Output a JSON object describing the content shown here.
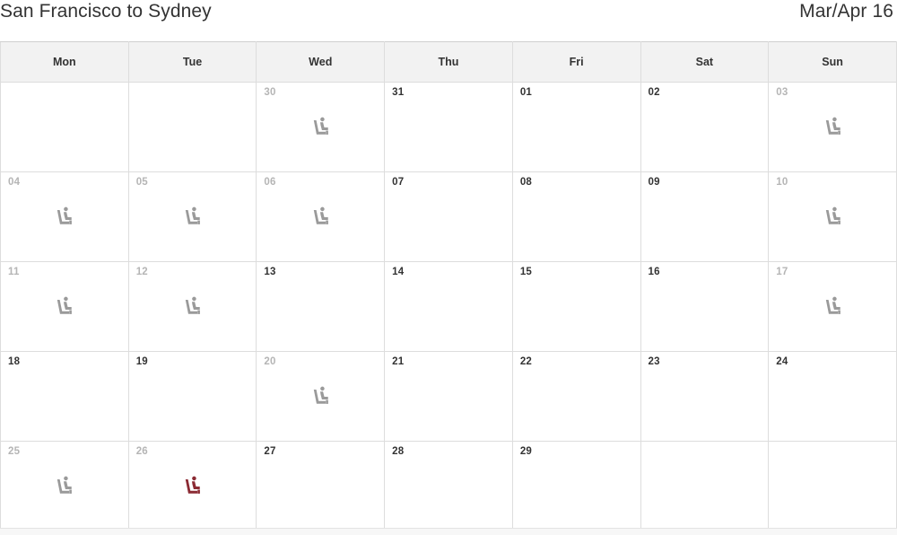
{
  "header": {
    "route_title": "San Francisco to Sydney",
    "period_title": "Mar/Apr 16"
  },
  "calendar": {
    "weekday_headers": [
      "Mon",
      "Tue",
      "Wed",
      "Thu",
      "Fri",
      "Sat",
      "Sun"
    ],
    "colors": {
      "seat_available": "#9a9a9a",
      "seat_selected": "#8b2a33",
      "header_bg": "#f2f2f2",
      "grid_border": "#dddddd",
      "day_text": "#333333",
      "day_text_muted": "#b5b5b5"
    },
    "icon_name": "airline-seat-icon",
    "weeks": [
      {
        "days": [
          {
            "label": "",
            "muted": true,
            "icon": "none"
          },
          {
            "label": "",
            "muted": true,
            "icon": "none"
          },
          {
            "label": "30",
            "muted": true,
            "icon": "seat-available"
          },
          {
            "label": "31",
            "muted": false,
            "icon": "none"
          },
          {
            "label": "01",
            "muted": false,
            "icon": "none"
          },
          {
            "label": "02",
            "muted": false,
            "icon": "none"
          },
          {
            "label": "03",
            "muted": true,
            "icon": "seat-available"
          }
        ]
      },
      {
        "days": [
          {
            "label": "04",
            "muted": true,
            "icon": "seat-available"
          },
          {
            "label": "05",
            "muted": true,
            "icon": "seat-available"
          },
          {
            "label": "06",
            "muted": true,
            "icon": "seat-available"
          },
          {
            "label": "07",
            "muted": false,
            "icon": "none"
          },
          {
            "label": "08",
            "muted": false,
            "icon": "none"
          },
          {
            "label": "09",
            "muted": false,
            "icon": "none"
          },
          {
            "label": "10",
            "muted": true,
            "icon": "seat-available"
          }
        ]
      },
      {
        "days": [
          {
            "label": "11",
            "muted": true,
            "icon": "seat-available"
          },
          {
            "label": "12",
            "muted": true,
            "icon": "seat-available"
          },
          {
            "label": "13",
            "muted": false,
            "icon": "none"
          },
          {
            "label": "14",
            "muted": false,
            "icon": "none"
          },
          {
            "label": "15",
            "muted": false,
            "icon": "none"
          },
          {
            "label": "16",
            "muted": false,
            "icon": "none"
          },
          {
            "label": "17",
            "muted": true,
            "icon": "seat-available"
          }
        ]
      },
      {
        "days": [
          {
            "label": "18",
            "muted": false,
            "icon": "none"
          },
          {
            "label": "19",
            "muted": false,
            "icon": "none"
          },
          {
            "label": "20",
            "muted": true,
            "icon": "seat-available"
          },
          {
            "label": "21",
            "muted": false,
            "icon": "none"
          },
          {
            "label": "22",
            "muted": false,
            "icon": "none"
          },
          {
            "label": "23",
            "muted": false,
            "icon": "none"
          },
          {
            "label": "24",
            "muted": false,
            "icon": "none"
          }
        ]
      },
      {
        "days": [
          {
            "label": "25",
            "muted": true,
            "icon": "seat-available"
          },
          {
            "label": "26",
            "muted": true,
            "icon": "seat-selected"
          },
          {
            "label": "27",
            "muted": false,
            "icon": "none"
          },
          {
            "label": "28",
            "muted": false,
            "icon": "none"
          },
          {
            "label": "29",
            "muted": false,
            "icon": "none"
          },
          {
            "label": "",
            "muted": true,
            "icon": "none"
          },
          {
            "label": "",
            "muted": true,
            "icon": "none"
          }
        ]
      }
    ]
  }
}
